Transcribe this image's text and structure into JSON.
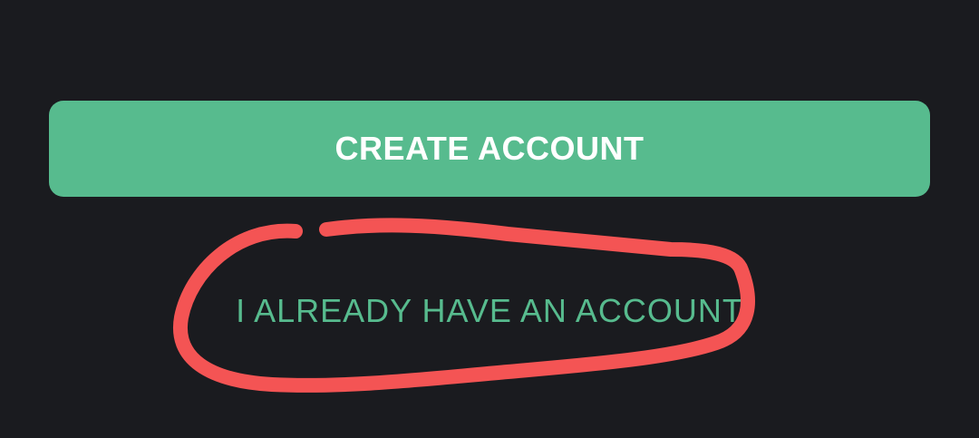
{
  "actions": {
    "create_account_label": "CREATE ACCOUNT",
    "existing_account_label": "I ALREADY HAVE AN ACCOUNT"
  },
  "colors": {
    "background": "#1a1b1f",
    "accent": "#57bb8e",
    "annotation": "#f45454"
  }
}
